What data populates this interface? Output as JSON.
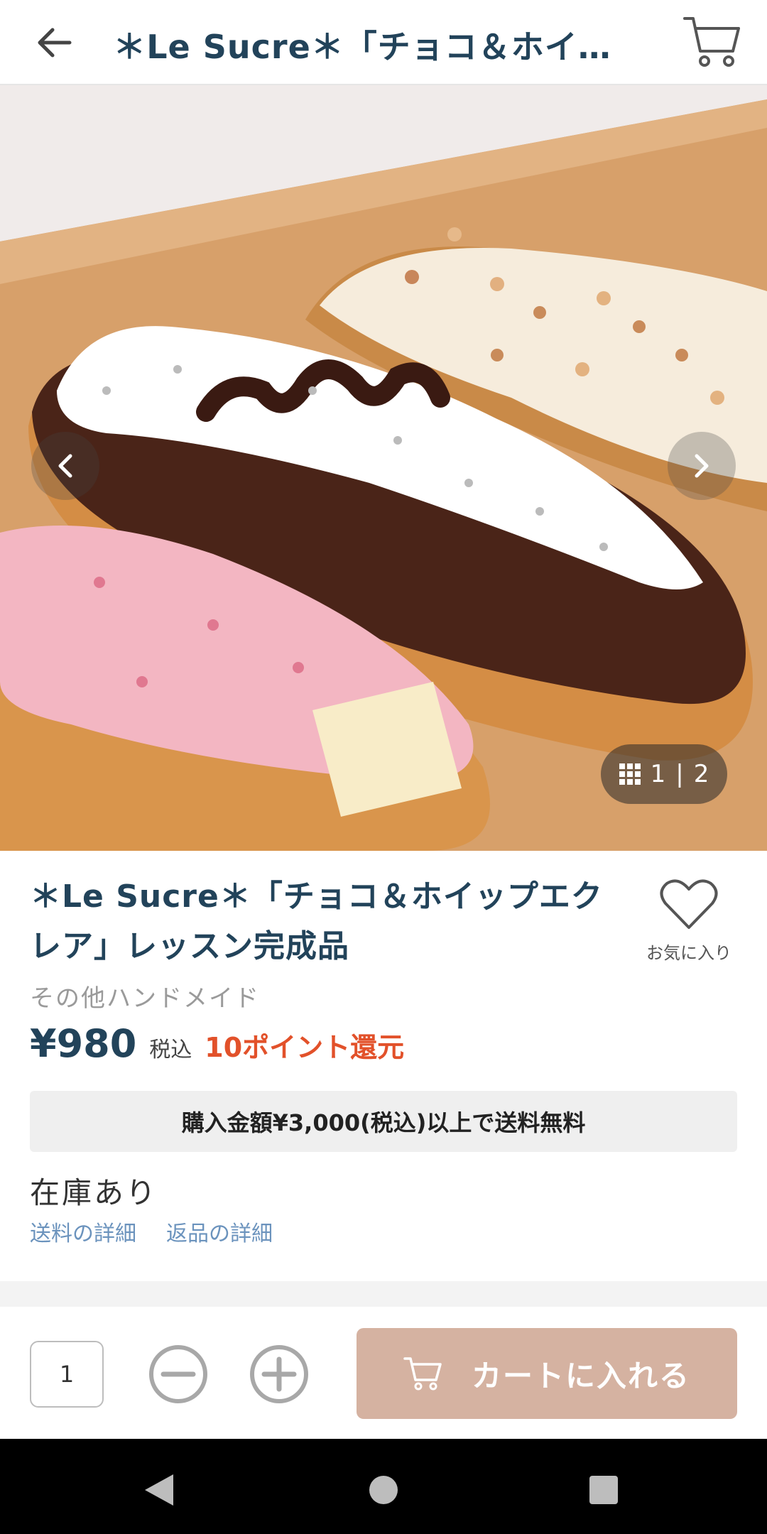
{
  "header": {
    "title": "＊Le Sucre＊「チョコ＆ホイ…",
    "back_icon": "arrow-left-icon",
    "cart_icon": "cart-icon"
  },
  "gallery": {
    "counter_current": "1",
    "counter_separator": "|",
    "counter_total": "2",
    "prev_icon": "chevron-left-icon",
    "next_icon": "chevron-right-icon",
    "grid_icon": "grid-icon"
  },
  "product": {
    "title": "＊Le Sucre＊「チョコ＆ホイップエクレア」レッスン完成品",
    "category": "その他ハンドメイド",
    "price": "¥980",
    "tax_label": "税込",
    "points": "10ポイント還元",
    "favorite_label": "お気に入り",
    "shipping_banner": "購入金額¥3,000(税込)以上で送料無料",
    "stock": "在庫あり",
    "shipping_details_link": "送料の詳細",
    "return_details_link": "返品の詳細"
  },
  "purchase": {
    "quantity": "1",
    "add_to_cart": "カートに入れる"
  },
  "colors": {
    "title": "#22435a",
    "points": "#e2512a",
    "add_to_cart_bg": "#d5b2a1",
    "link": "#6b93bd"
  }
}
